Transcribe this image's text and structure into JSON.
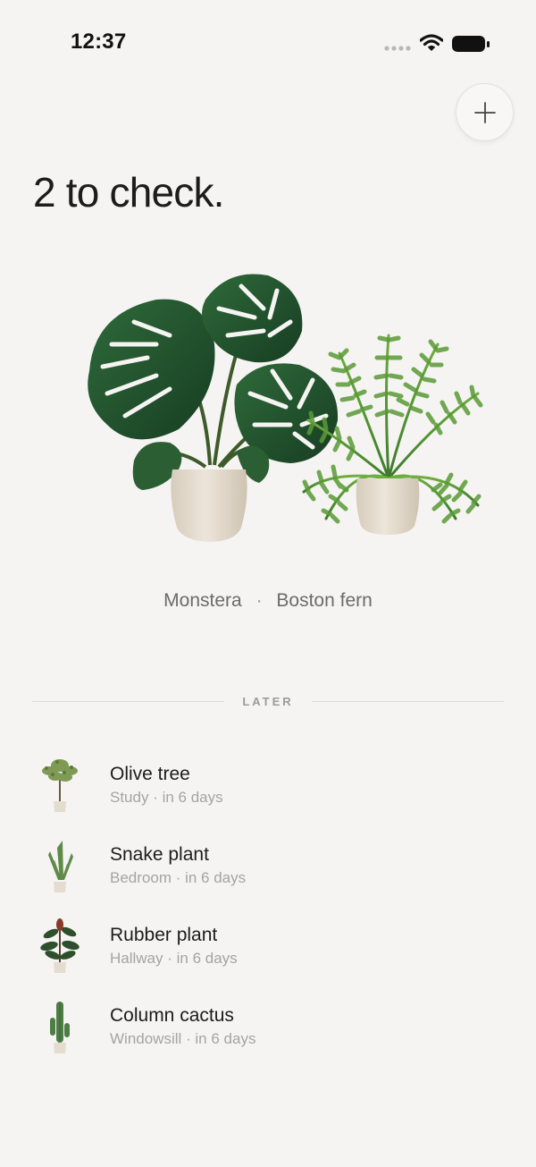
{
  "status_bar": {
    "time": "12:37",
    "icons": [
      "signal-dots-icon",
      "wifi-icon",
      "battery-icon"
    ]
  },
  "header": {
    "add_icon": "plus-icon"
  },
  "headline": "2 to check.",
  "hero": {
    "plants": [
      "Monstera",
      "Boston fern"
    ],
    "separator": "·"
  },
  "section": {
    "label": "LATER"
  },
  "later": [
    {
      "name": "Olive tree",
      "room": "Study",
      "when": "in 6 days",
      "subtitle": "Study · in 6 days",
      "icon": "olive-tree-icon"
    },
    {
      "name": "Snake plant",
      "room": "Bedroom",
      "when": "in 6 days",
      "subtitle": "Bedroom · in 6 days",
      "icon": "snake-plant-icon"
    },
    {
      "name": "Rubber plant",
      "room": "Hallway",
      "when": "in 6 days",
      "subtitle": "Hallway · in 6 days",
      "icon": "rubber-plant-icon"
    },
    {
      "name": "Column cactus",
      "room": "Windowsill",
      "when": "in 6 days",
      "subtitle": "Windowsill · in 6 days",
      "icon": "column-cactus-icon"
    }
  ],
  "colors": {
    "background": "#f5f4f2",
    "text_primary": "#1c1c1c",
    "text_secondary": "#a4a4a4",
    "leaf_dark": "#1f4a2b",
    "leaf_light": "#4f8f3a",
    "pot": "#e4dccf"
  }
}
